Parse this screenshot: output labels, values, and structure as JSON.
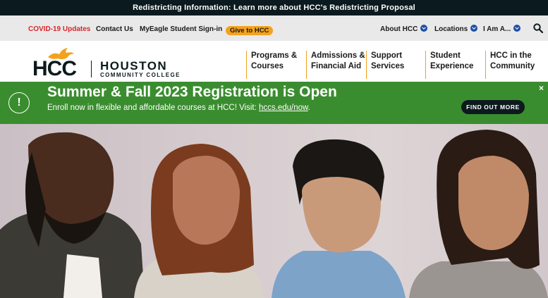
{
  "announcement": {
    "text": "Redistricting Information: Learn more about HCC's Redistricting Proposal"
  },
  "utility": {
    "covid": "COVID-19 Updates",
    "contact": "Contact Us",
    "myeagle": "MyEagle Student Sign-in",
    "give": "Give to HCC",
    "about": "About HCC",
    "locations": "Locations",
    "iam": "I Am A...",
    "search_icon": "search-icon"
  },
  "logo": {
    "hcc": "HCC",
    "houston": "HOUSTON",
    "sub": "COMMUNITY COLLEGE"
  },
  "nav": [
    {
      "line1": "Programs &",
      "line2": "Courses"
    },
    {
      "line1": "Admissions &",
      "line2": "Financial Aid"
    },
    {
      "line1": "Support",
      "line2": "Services"
    },
    {
      "line1": "Student",
      "line2": "Experience"
    },
    {
      "line1": "HCC in the",
      "line2": "Community"
    }
  ],
  "promo": {
    "icon": "!",
    "title": "Summer & Fall 2023 Registration is Open",
    "sub": "Enroll now in flexible and affordable courses at HCC! Visit: ",
    "link": "hccs.edu/now",
    "period": ".",
    "button": "FIND OUT MORE",
    "close": "×"
  },
  "colors": {
    "accent": "#f4a21c",
    "promo_green": "#3a8d2f",
    "covid_red": "#d7262d",
    "dark": "#0d1a1d",
    "chevron_blue": "#1d4fa3"
  }
}
